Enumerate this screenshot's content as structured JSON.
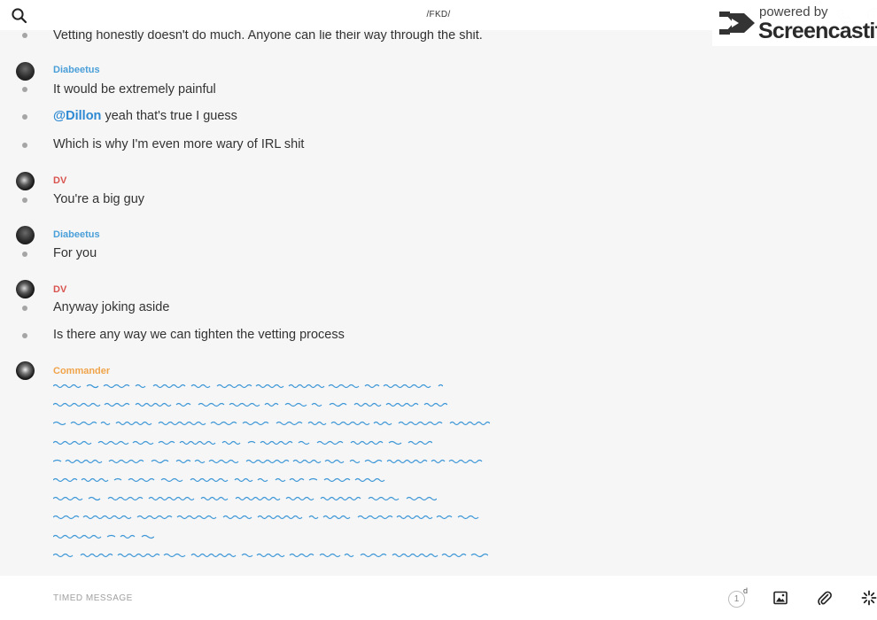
{
  "header": {
    "title": "/FKD/",
    "search_icon": "search-icon",
    "phone_icon": "phone-icon",
    "info_icon": "info-icon"
  },
  "watermark": {
    "powered": "powered by",
    "brand": "Screencastify"
  },
  "colors": {
    "diabeetus": "#4a9fd8",
    "dv": "#d9534f",
    "commander": "#f0a44a",
    "mention": "#2d89d2",
    "scribble": "#3d97d6"
  },
  "messages": {
    "m0": "Vetting honestly doesn't do much. Anyone can lie their way through the shit.",
    "g1": {
      "author": "Diabeetus",
      "m1": "It would be extremely painful",
      "m2_mention": "@Dillon",
      "m2_text": " yeah that's true I guess",
      "m3": "Which is why I'm even more wary of IRL shit"
    },
    "g2": {
      "author": "DV",
      "m1": "You're a big guy"
    },
    "g3": {
      "author": "Diabeetus",
      "m1": "For you"
    },
    "g4": {
      "author": "DV",
      "m1": "Anyway joking aside",
      "m2": "Is there any way we can tighten the vetting process"
    },
    "g5": {
      "author": "Commander"
    }
  },
  "composer": {
    "placeholder": "TIMED MESSAGE",
    "timer_value": "1",
    "timer_unit": "d",
    "image_icon": "image-icon",
    "attach_icon": "paperclip-icon",
    "emoji_icon": "sparkle-icon"
  }
}
